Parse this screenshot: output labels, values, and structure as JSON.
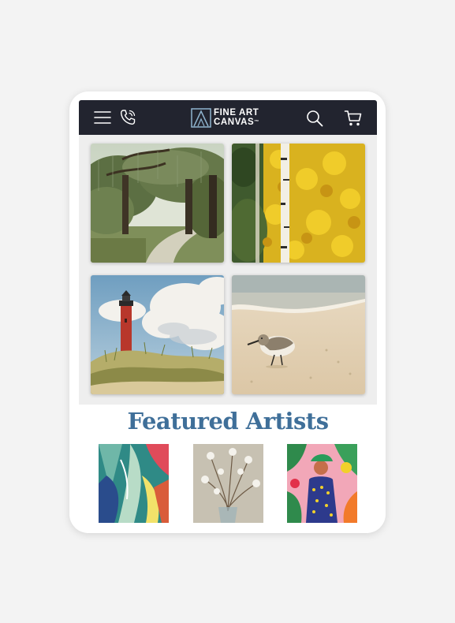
{
  "header": {
    "logo_line1": "FINE ART",
    "logo_line2": "CANVAS",
    "logo_tm": "™",
    "icons": [
      "menu-icon",
      "phone-icon",
      "search-icon",
      "cart-icon"
    ]
  },
  "gallery": {
    "tiles": [
      {
        "name": "oak-path-painting"
      },
      {
        "name": "birch-aspen-painting"
      },
      {
        "name": "lighthouse-painting"
      },
      {
        "name": "sandpiper-painting"
      }
    ]
  },
  "featured": {
    "title": "Featured Artists",
    "artists": [
      {
        "name": "abstract-leaves-artwork"
      },
      {
        "name": "cotton-vase-artwork"
      },
      {
        "name": "tropical-woman-artwork"
      }
    ]
  },
  "colors": {
    "header_bg": "#22242f",
    "title_blue": "#3f6f99",
    "page_bg": "#f3f3f3"
  }
}
